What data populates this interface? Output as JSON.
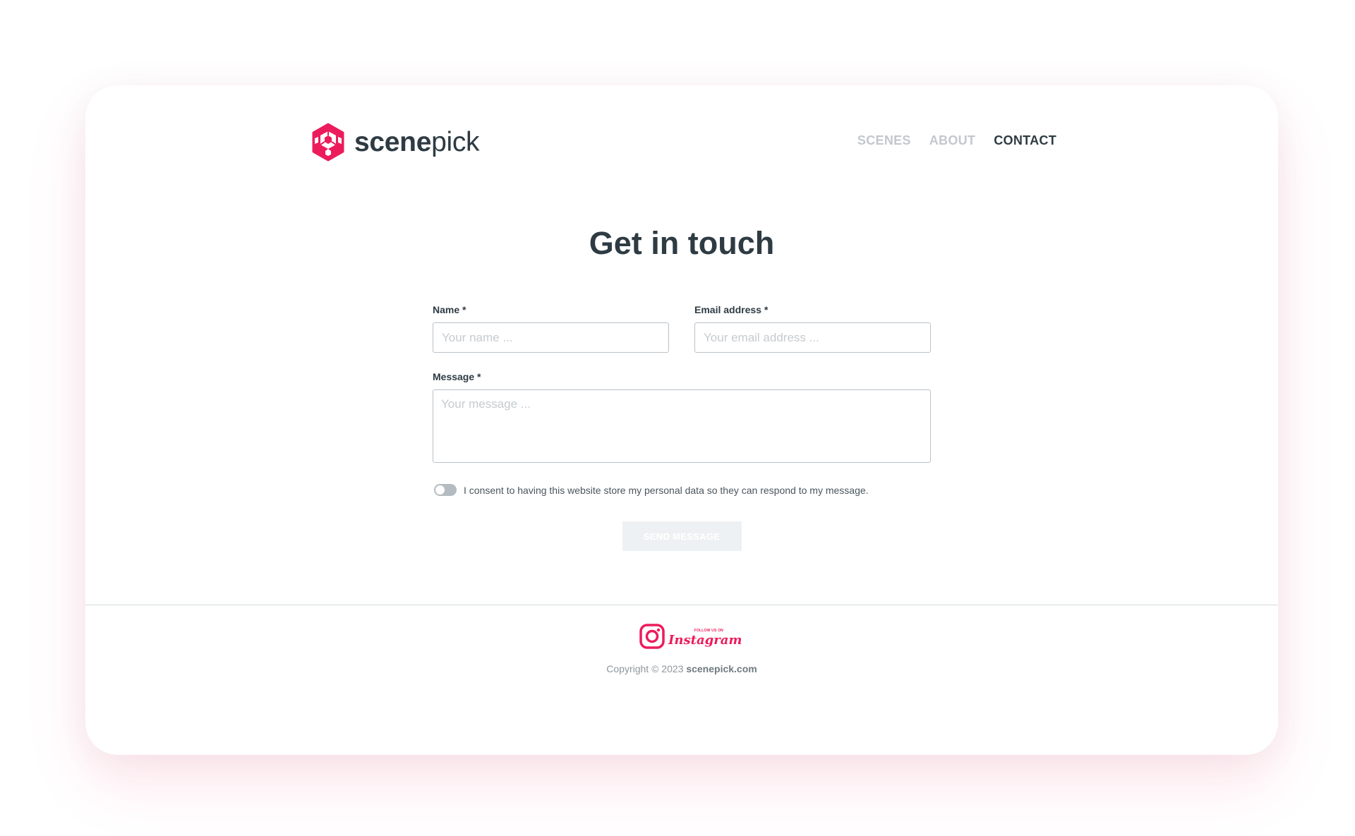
{
  "brand": {
    "name_strong": "scene",
    "name_light": "pick",
    "accent_color": "#ec1c5c",
    "text_color": "#2e3b43"
  },
  "nav": {
    "items": [
      {
        "label": "SCENES",
        "active": false
      },
      {
        "label": "ABOUT",
        "active": false
      },
      {
        "label": "CONTACT",
        "active": true
      }
    ]
  },
  "page": {
    "title": "Get in touch"
  },
  "form": {
    "name": {
      "label": "Name *",
      "placeholder": "Your name ...",
      "value": ""
    },
    "email": {
      "label": "Email address *",
      "placeholder": "Your email address ...",
      "value": ""
    },
    "message": {
      "label": "Message *",
      "placeholder": "Your message ...",
      "value": ""
    },
    "consent": {
      "text": "I consent to having this website store my personal data so they can respond to my message.",
      "checked": false
    },
    "submit_label": "SEND MESSAGE",
    "submit_disabled": true
  },
  "footer": {
    "social": {
      "follow_text": "FOLLOW US ON",
      "network": "Instagram",
      "icon": "instagram-icon"
    },
    "copyright_prefix": "Copyright © 2023",
    "copyright_domain": "scenepick.com"
  }
}
